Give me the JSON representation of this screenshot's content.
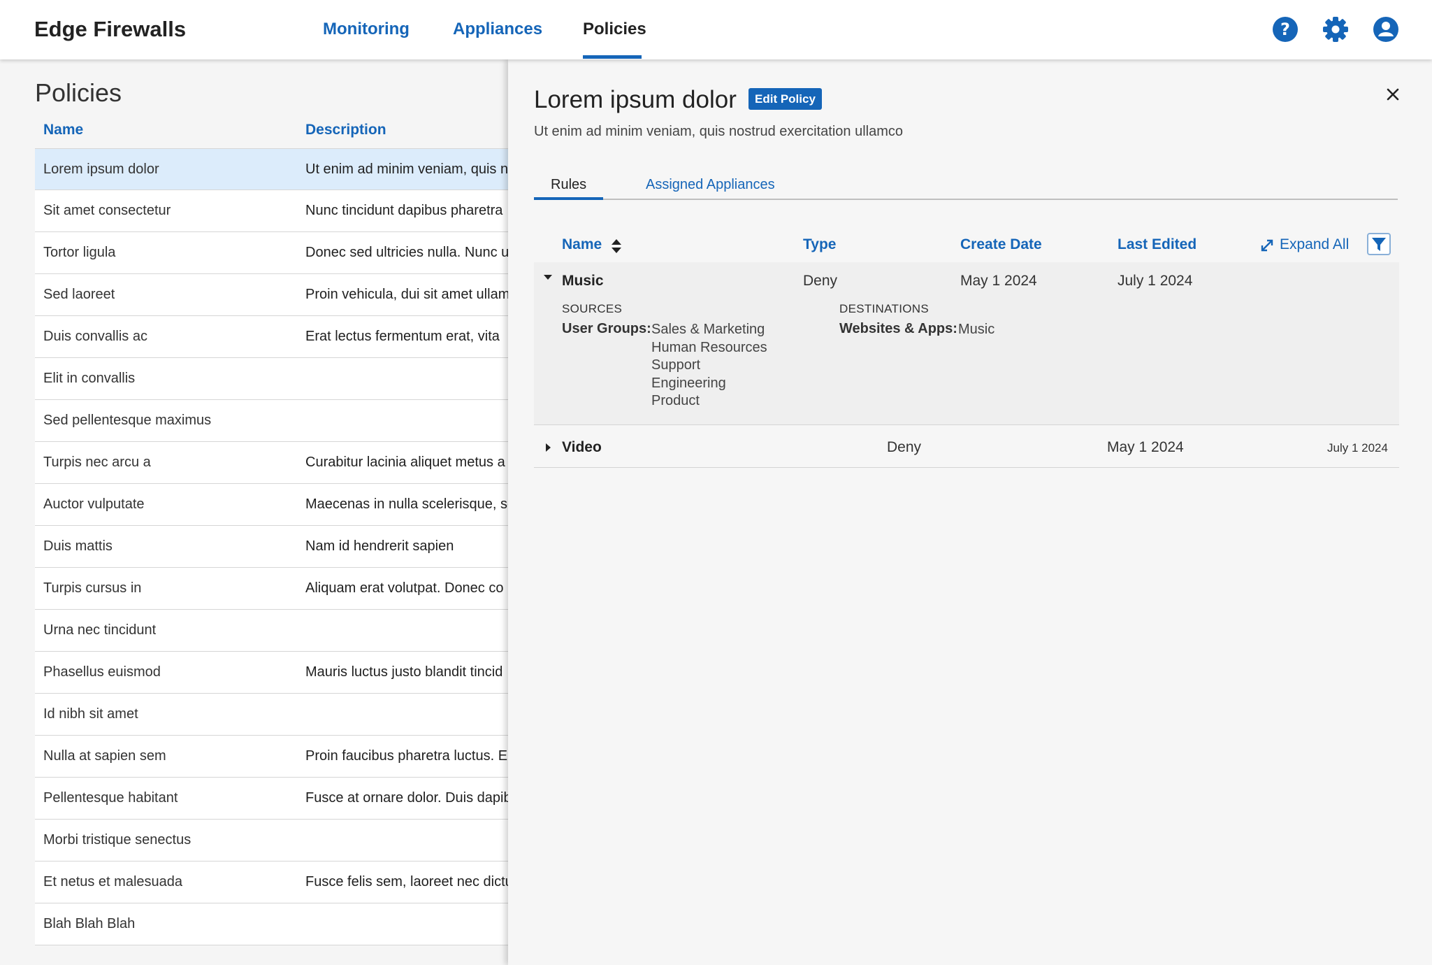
{
  "app": {
    "title": "Edge Firewalls"
  },
  "nav": [
    {
      "label": "Monitoring"
    },
    {
      "label": "Appliances"
    },
    {
      "label": "Policies"
    }
  ],
  "top_icons": [
    "help-icon",
    "gear-icon",
    "user-icon"
  ],
  "colors": {
    "accent": "#1565b8",
    "selected_row": "#dcecfb"
  },
  "policies": {
    "title": "Policies",
    "columns": [
      "Name",
      "Description"
    ],
    "rows": [
      {
        "name": "Lorem ipsum dolor",
        "description": "Ut enim ad minim veniam, quis n"
      },
      {
        "name": "Sit amet consectetur",
        "description": "Nunc tincidunt dapibus pharetra"
      },
      {
        "name": "Tortor ligula",
        "description": "Donec sed ultricies nulla. Nunc u"
      },
      {
        "name": "Sed laoreet",
        "description": "Proin vehicula, dui sit amet ullam"
      },
      {
        "name": "Duis convallis ac",
        "description": "Erat lectus fermentum erat, vita"
      },
      {
        "name": "Elit in  convallis",
        "description": ""
      },
      {
        "name": "Sed pellentesque maximus",
        "description": ""
      },
      {
        "name": "Turpis nec arcu a",
        "description": "Curabitur lacinia aliquet metus a"
      },
      {
        "name": "Auctor vulputate",
        "description": "Maecenas in nulla scelerisque, se"
      },
      {
        "name": "Duis mattis",
        "description": "Nam id hendrerit sapien"
      },
      {
        "name": "Turpis cursus in",
        "description": "Aliquam erat volutpat. Donec co"
      },
      {
        "name": "Urna nec tincidunt",
        "description": ""
      },
      {
        "name": "Phasellus euismod",
        "description": "Mauris luctus justo blandit tincid"
      },
      {
        "name": "Id nibh sit amet",
        "description": ""
      },
      {
        "name": "Nulla at sapien sem",
        "description": "Proin faucibus pharetra luctus. E"
      },
      {
        "name": "Pellentesque habitant",
        "description": "Fusce at ornare dolor. Duis dapib"
      },
      {
        "name": "Morbi tristique senectus",
        "description": ""
      },
      {
        "name": "Et netus et malesuada",
        "description": "Fusce felis sem, laoreet nec dictu"
      },
      {
        "name": "Blah Blah Blah",
        "description": ""
      }
    ]
  },
  "detail": {
    "title": "Lorem ipsum dolor",
    "edit_label": "Edit Policy",
    "description": "Ut enim ad minim veniam, quis nostrud exercitation ullamco",
    "tabs": [
      {
        "label": "Rules"
      },
      {
        "label": "Assigned Appliances"
      }
    ],
    "rules_columns": [
      "Name",
      "Type",
      "Create Date",
      "Last Edited"
    ],
    "expand_all_label": "Expand All",
    "rules": [
      {
        "name": "Music",
        "type": "Deny",
        "create_date": "May 1 2024",
        "last_edited": "July 1 2024",
        "expanded": true,
        "sources_label": "SOURCES",
        "sources_key": "User Groups:",
        "sources": [
          "Sales & Marketing",
          "Human Resources",
          "Support",
          "Engineering",
          "Product"
        ],
        "destinations_label": "DESTINATIONS",
        "destinations_key": "Websites & Apps:",
        "destinations": [
          "Music"
        ]
      },
      {
        "name": "Video",
        "type": "Deny",
        "create_date": "May 1 2024",
        "last_edited": "July 1 2024",
        "expanded": false
      }
    ]
  }
}
